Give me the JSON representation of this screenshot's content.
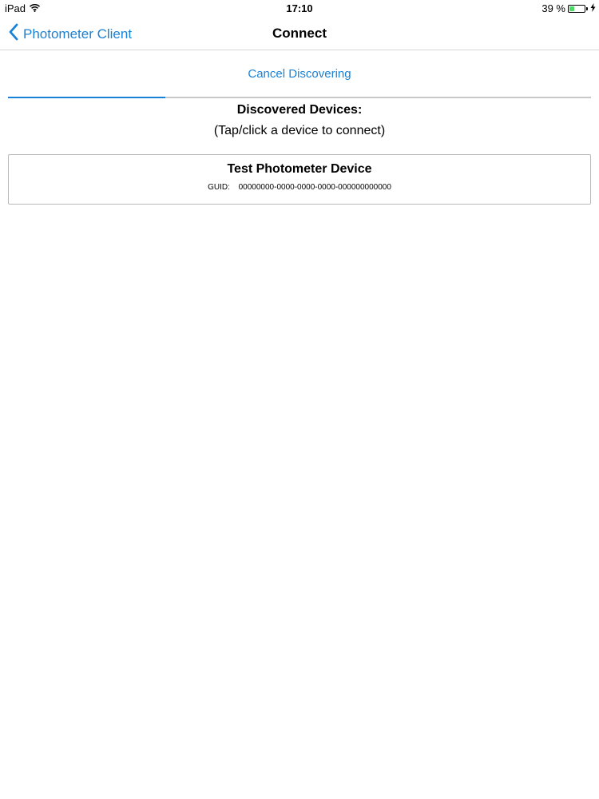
{
  "status_bar": {
    "carrier": "iPad",
    "time": "17:10",
    "battery_percent_text": "39 %",
    "battery_level": 0.39,
    "icons": [
      "wifi-icon",
      "battery-icon",
      "charging-bolt-icon"
    ],
    "battery_color": "#4cd964"
  },
  "nav": {
    "back_label": "Photometer Client",
    "title": "Connect",
    "accent_color": "#1a82d6"
  },
  "discovery": {
    "cancel_label": "Cancel Discovering",
    "progress": 0.27,
    "title": "Discovered Devices:",
    "subtitle": "(Tap/click a device to connect)"
  },
  "devices": [
    {
      "name": "Test Photometer Device",
      "guid_label": "GUID:",
      "guid": "00000000-0000-0000-0000-000000000000"
    }
  ]
}
